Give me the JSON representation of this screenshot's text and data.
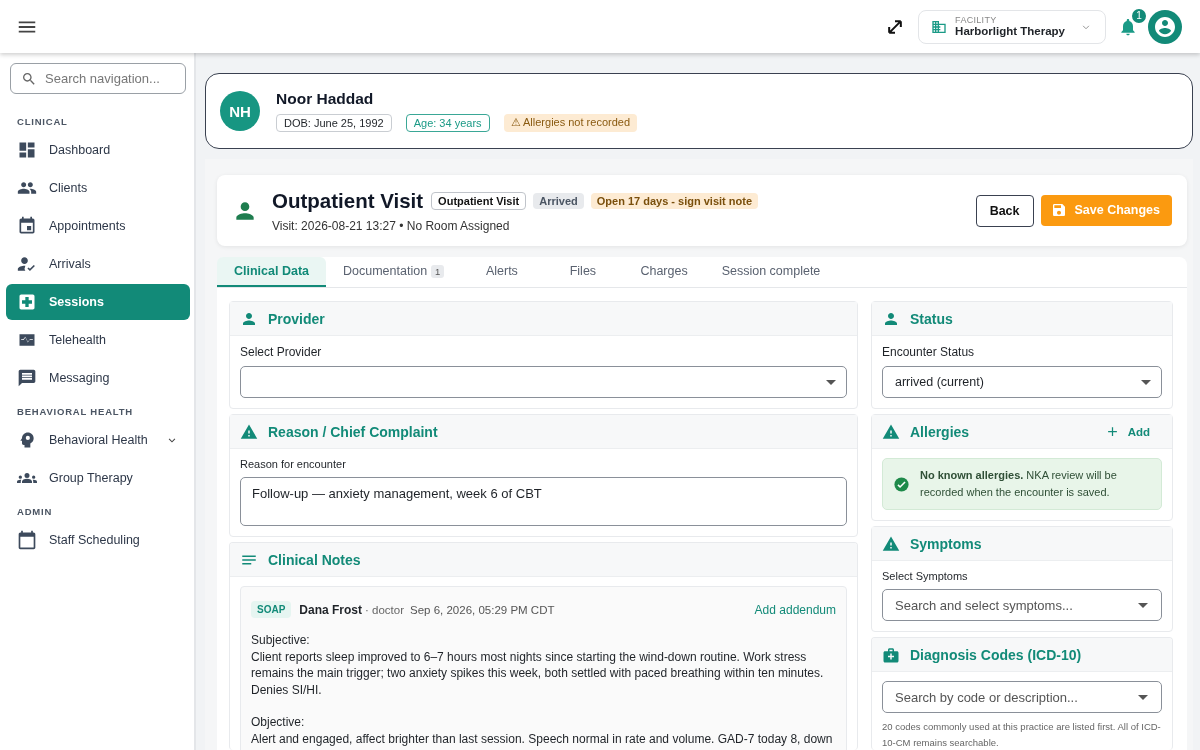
{
  "topbar": {
    "facility_label": "FACILITY",
    "facility_name": "Harborlight Therapy",
    "notification_count": "1"
  },
  "sidebar": {
    "search_placeholder": "Search navigation...",
    "sections": [
      {
        "title": "CLINICAL",
        "items": [
          {
            "label": "Dashboard",
            "selected": false,
            "expandable": false
          },
          {
            "label": "Clients",
            "selected": false,
            "expandable": false
          },
          {
            "label": "Appointments",
            "selected": false,
            "expandable": false
          },
          {
            "label": "Arrivals",
            "selected": false,
            "expandable": false
          },
          {
            "label": "Sessions",
            "selected": true,
            "expandable": false
          },
          {
            "label": "Telehealth",
            "selected": false,
            "expandable": false
          },
          {
            "label": "Messaging",
            "selected": false,
            "expandable": false
          }
        ]
      },
      {
        "title": "BEHAVIORAL HEALTH",
        "items": [
          {
            "label": "Behavioral Health",
            "selected": false,
            "expandable": true
          },
          {
            "label": "Group Therapy",
            "selected": false,
            "expandable": false
          }
        ]
      },
      {
        "title": "ADMIN",
        "items": [
          {
            "label": "Staff Scheduling",
            "selected": false,
            "expandable": false
          }
        ]
      }
    ]
  },
  "patient": {
    "initials": "NH",
    "name": "Noor Haddad",
    "dob": "DOB: June 25, 1992",
    "age": "Age: 34 years",
    "allergy_warning": "⚠ Allergies not recorded"
  },
  "visit": {
    "title": "Outpatient Visit",
    "badges": [
      {
        "text": "Outpatient Visit",
        "kind": "outline"
      },
      {
        "text": "Arrived",
        "kind": "neutral"
      },
      {
        "text": "Open 17 days - sign visit note",
        "kind": "warning"
      }
    ],
    "subtitle": "Visit: 2026-08-21 13:27 • No Room Assigned",
    "buttons": [
      {
        "label": "Back",
        "kind": "secondary"
      },
      {
        "label": "Save Changes",
        "kind": "primary"
      }
    ]
  },
  "tabs": [
    {
      "label": "Clinical Data",
      "selected": true
    },
    {
      "label": "Documentation",
      "count": "1",
      "selected": false
    },
    {
      "label": "Alerts",
      "selected": false
    },
    {
      "label": "Files",
      "selected": false
    },
    {
      "label": "Charges",
      "selected": false
    },
    {
      "label": "Session complete",
      "selected": false
    }
  ],
  "provider": {
    "title": "Provider",
    "field_label": "Select Provider"
  },
  "reason": {
    "title": "Reason / Chief Complaint",
    "field_label": "Reason for encounter",
    "value": "Follow-up — anxiety management, week 6 of CBT"
  },
  "clinical_notes": {
    "title": "Clinical Notes",
    "notes": [
      {
        "type": "SOAP",
        "author": "Dana Frost",
        "role": "· doctor",
        "timestamp": "Sep 6, 2026, 05:29 PM CDT",
        "action": "Add addendum",
        "sections": [
          {
            "heading": "Subjective:",
            "text": "Client reports sleep improved to 6–7 hours most nights since starting the wind-down routine. Work stress remains the main trigger; two anxiety spikes this week, both settled with paced breathing within ten minutes. Denies SI/HI."
          },
          {
            "heading": "Objective:",
            "text": "Alert and engaged, affect brighter than last session. Speech normal in rate and volume. GAD-7 today 8, down"
          }
        ]
      }
    ]
  },
  "status": {
    "title": "Status",
    "field_label": "Encounter Status",
    "value": "arrived (current)"
  },
  "allergies": {
    "title": "Allergies",
    "add_label": "Add",
    "message": "**No known allergies.** NKA review will be recorded when the encounter is saved."
  },
  "symptoms": {
    "title": "Symptoms",
    "field_label": "Select Symptoms",
    "placeholder": "Search and select symptoms..."
  },
  "diagnosis": {
    "title": "Diagnosis Codes (ICD-10)",
    "placeholder": "Search by code or description...",
    "hint": "20 codes commonly used at this practice are listed first. All of ICD-10-CM remains searchable."
  }
}
